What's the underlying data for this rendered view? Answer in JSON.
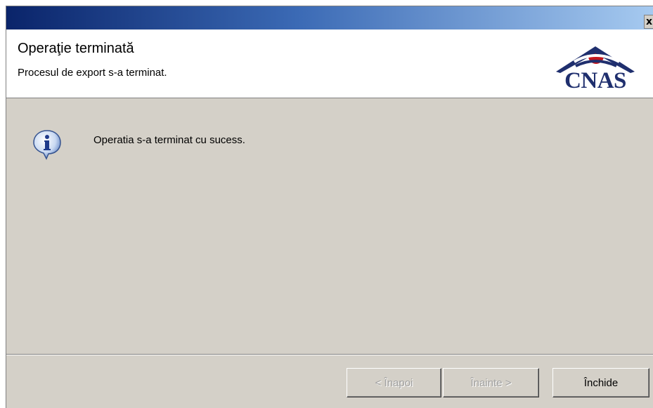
{
  "window": {
    "close_glyph": "x"
  },
  "header": {
    "title": "Operaţie terminată",
    "subtitle": "Procesul de export s-a terminat.",
    "logo_text": "CNAS"
  },
  "content": {
    "icon": "info-icon",
    "message": "Operatia s-a terminat cu sucess."
  },
  "footer": {
    "back_label": "< Înapoi",
    "next_label": "Înainte >",
    "close_label": "Închide"
  },
  "colors": {
    "titlebar_start": "#0a246a",
    "titlebar_end": "#a6caf0",
    "dialog_bg": "#d4d0c8",
    "logo_blue": "#1f2f6e",
    "logo_red": "#c4161c"
  }
}
